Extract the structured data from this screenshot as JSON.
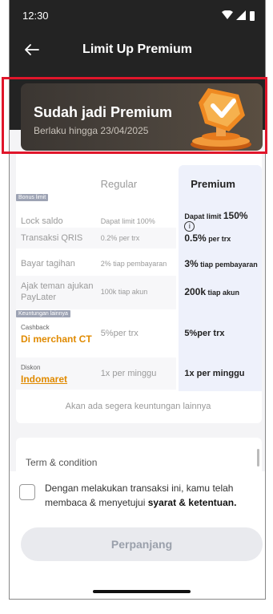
{
  "status": {
    "time": "12:30"
  },
  "header": {
    "title": "Limit Up Premium"
  },
  "premium_card": {
    "title": "Sudah jadi Premium",
    "subtitle": "Berlaku hingga 23/04/2025"
  },
  "table": {
    "col_regular": "Regular",
    "col_premium": "Premium",
    "tag_bonus": "Bonus limit",
    "tag_benefits": "Keuntungan lainnya",
    "rows": [
      {
        "label": "Lock saldo",
        "regular": "Dapat limit 100%",
        "premium_text": "Dapat limit ",
        "premium_value": "150%"
      },
      {
        "label": "Transaksi QRIS",
        "regular": "0.2% per trx",
        "premium_value": "0.5%",
        "premium_text": " per trx"
      },
      {
        "label": "Bayar tagihan",
        "regular": "2% tiap pembayaran",
        "premium_value": "3%",
        "premium_text": " tiap pembayaran"
      },
      {
        "label": "Ajak teman ajukan PayLater",
        "regular": "100k tiap akun",
        "premium_value": "200k",
        "premium_text": " tiap akun"
      }
    ],
    "benefits": [
      {
        "small": "Cashback",
        "brand": "Di merchant CT",
        "regular": "5%per trx",
        "premium": "5%per trx"
      },
      {
        "small": "Diskon",
        "brand": "Indomaret",
        "regular": "1x per minggu",
        "premium": "1x per minggu"
      }
    ],
    "note": "Akan ada segera keuntungan lainnya"
  },
  "term": {
    "title": "Term & condition"
  },
  "agreement": {
    "text": "Dengan melakukan transaksi ini, kamu telah membaca & menyetujui ",
    "link": "syarat & ketentuan."
  },
  "button": {
    "label": "Perpanjang"
  },
  "icons": [
    "back-arrow-icon",
    "wifi-icon",
    "signal-icon",
    "battery-icon",
    "info-icon",
    "medal-icon"
  ],
  "colors": {
    "header_bg": "#232323",
    "accent_orange": "#e08a00",
    "highlight_red": "#e0162b"
  }
}
